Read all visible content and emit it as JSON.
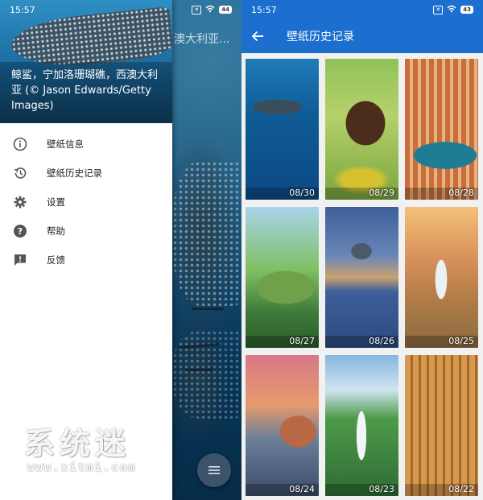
{
  "left": {
    "status": {
      "time": "15:57",
      "battery": "44"
    },
    "peek_title": "澳大利亚...",
    "drawer": {
      "caption": "鲸鲨，宁加洛珊瑚礁，西澳大利亚 (© Jason Edwards/Getty Images)",
      "items": [
        {
          "label": "壁纸信息",
          "icon": "info-icon"
        },
        {
          "label": "壁纸历史记录",
          "icon": "history-icon"
        },
        {
          "label": "设置",
          "icon": "gear-icon"
        },
        {
          "label": "帮助",
          "icon": "help-icon"
        },
        {
          "label": "反馈",
          "icon": "feedback-icon"
        }
      ]
    },
    "fab_icon": "menu-icon"
  },
  "watermark": {
    "title": "系统迷",
    "url": "www.xitmi.com"
  },
  "right": {
    "status": {
      "time": "15:57",
      "battery": "43"
    },
    "title": "壁纸历史记录",
    "accent": "#1c6fce",
    "tiles": [
      {
        "date": "08/30"
      },
      {
        "date": "08/29"
      },
      {
        "date": "08/28"
      },
      {
        "date": "08/27"
      },
      {
        "date": "08/26"
      },
      {
        "date": "08/25"
      },
      {
        "date": "08/24"
      },
      {
        "date": "08/23"
      },
      {
        "date": "08/22"
      }
    ]
  }
}
